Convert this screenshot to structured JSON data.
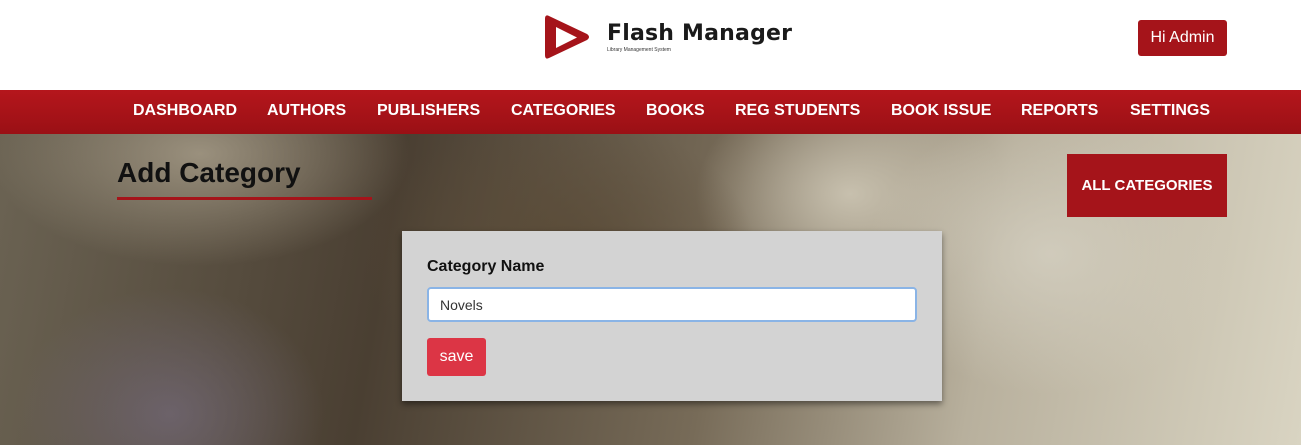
{
  "brand": {
    "title": "Flash Manager",
    "subtitle": "Library Management System",
    "accent": "#a5141a"
  },
  "header": {
    "user_button": "Hi Admin"
  },
  "nav": {
    "items": [
      {
        "label": "DASHBOARD"
      },
      {
        "label": "AUTHORS"
      },
      {
        "label": "PUBLISHERS"
      },
      {
        "label": "CATEGORIES"
      },
      {
        "label": "BOOKS"
      },
      {
        "label": "REG STUDENTS"
      },
      {
        "label": "BOOK ISSUE"
      },
      {
        "label": "REPORTS"
      },
      {
        "label": "SETTINGS"
      }
    ]
  },
  "page": {
    "title": "Add Category",
    "all_button": "ALL CATEGORIES"
  },
  "form": {
    "label": "Category Name",
    "value": "Novels",
    "save_label": "save"
  }
}
